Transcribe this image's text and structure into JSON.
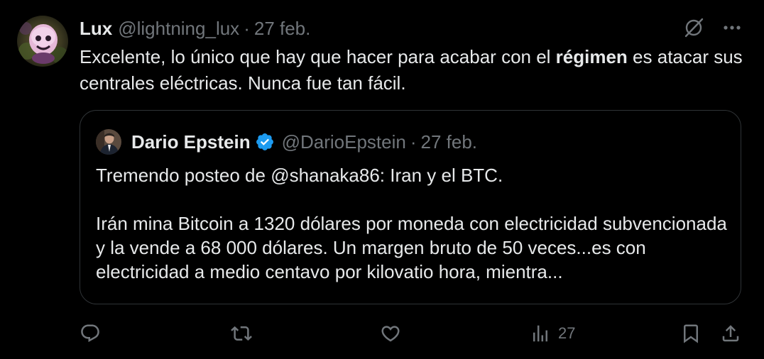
{
  "tweet": {
    "author": {
      "display_name": "Lux",
      "handle": "@lightning_lux",
      "separator": "·",
      "date": "27 feb."
    },
    "text": {
      "part1": "Excelente, lo único que hay que hacer para acabar con el ",
      "bold": "régimen",
      "part2": " es atacar sus centrales eléctricas. Nunca fue tan fácil."
    },
    "top_icons": [
      "grok-icon",
      "more-icon"
    ]
  },
  "quote": {
    "author": {
      "display_name": "Dario Epstein",
      "verified": true,
      "handle": "@DarioEpstein",
      "separator": "·",
      "date": "27 feb."
    },
    "paragraph1": "Tremendo posteo de @shanaka86: Iran y el BTC.",
    "paragraph2": "Irán mina Bitcoin a 1320 dólares por moneda con electricidad subvencionada y la vende a 68 000 dólares. Un margen bruto de 50 veces...es con electricidad a medio centavo por kilovatio hora, mientra..."
  },
  "actions": {
    "reply_icon": "reply-icon",
    "retweet_icon": "retweet-icon",
    "like_icon": "like-icon",
    "views_icon": "views-icon",
    "views_count": "27",
    "bookmark_icon": "bookmark-icon",
    "share_icon": "share-icon"
  },
  "colors": {
    "background": "#000000",
    "text": "#e7e9ea",
    "secondary": "#71767b",
    "border": "#2f3336",
    "verified": "#1d9bf0"
  }
}
